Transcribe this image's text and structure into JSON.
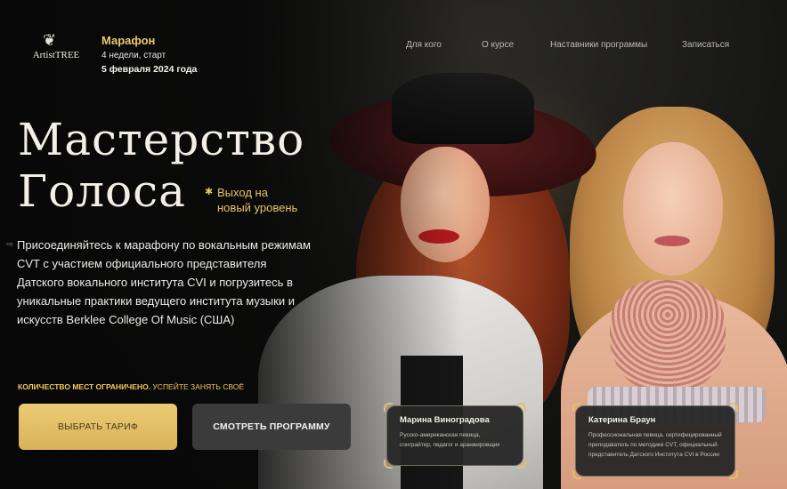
{
  "brand": {
    "logo_text": "ArtistTREE",
    "logo_icon": "tree-icon"
  },
  "marathon": {
    "title": "Марафон",
    "duration": "4 недели, старт",
    "date": "5 февраля 2024 года"
  },
  "nav": {
    "items": [
      "Для кого",
      "О курсе",
      "Наставники программы",
      "Записаться"
    ]
  },
  "hero": {
    "title_line1": "Мастерство",
    "title_line2": "Голоса",
    "tagline_line1": "Выход на",
    "tagline_line2": "новый уровень",
    "description": "Присоединяйтесь к марафону по вокальным режимам CVT с участием официального представителя Датского вокального института CVI и погрузитесь в уникальные практики ведущего института музыки и искусств Berklee College Of Music (США)",
    "limited_bold": "КОЛИЧЕСТВО МЕСТ ОГРАНИЧЕНО.",
    "limited_rest": " УСПЕЙТЕ ЗАНЯТЬ СВОЁ"
  },
  "buttons": {
    "primary": "ВЫБРАТЬ ТАРИФ",
    "secondary": "СМОТРЕТЬ ПРОГРАММУ"
  },
  "mentors": [
    {
      "name": "Марина Виноградова",
      "description": "Русско-американская певица, сонграйтер, педагог и аранжировщик"
    },
    {
      "name": "Катерина Браун",
      "description": "Профессиональная певица, сертифицированный преподаватель по методике CVT, официальный представитель Датского Института CVI в России"
    }
  ],
  "colors": {
    "accent_gold": "#e8c46a",
    "background": "#0d0d0d"
  }
}
